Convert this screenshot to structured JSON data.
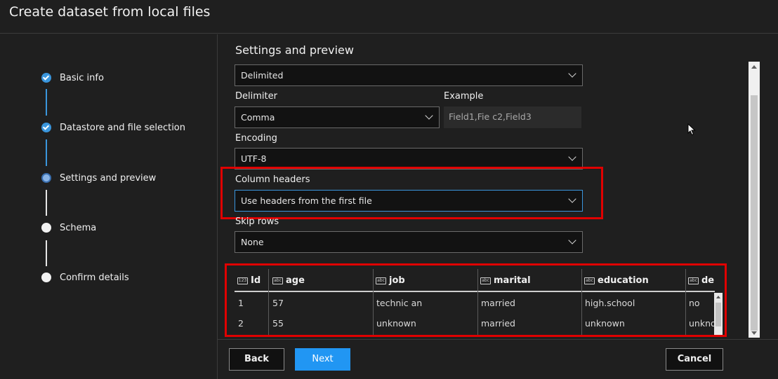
{
  "window": {
    "title": "Create dataset from local files"
  },
  "steps": [
    {
      "label": "Basic info",
      "state": "done"
    },
    {
      "label": "Datastore and file selection",
      "state": "done"
    },
    {
      "label": "Settings and preview",
      "state": "active"
    },
    {
      "label": "Schema",
      "state": "todo"
    },
    {
      "label": "Confirm details",
      "state": "todo"
    }
  ],
  "settings": {
    "section_title": "Settings and preview",
    "file_format": {
      "value": "Delimited"
    },
    "delimiter": {
      "label": "Delimiter",
      "value": "Comma"
    },
    "example": {
      "label": "Example",
      "value": "Field1,Fie c2,Field3"
    },
    "encoding": {
      "label": "Encoding",
      "value": "UTF-8"
    },
    "column_headers": {
      "label": "Column headers",
      "value": "Use headers from the first file"
    },
    "skip_rows": {
      "label": "Skip rows",
      "value": "None"
    }
  },
  "preview": {
    "columns": [
      {
        "name": "Id",
        "type_icon": "numeric-icon"
      },
      {
        "name": "age",
        "type_icon": "text-icon"
      },
      {
        "name": "job",
        "type_icon": "text-icon"
      },
      {
        "name": "marital",
        "type_icon": "text-icon"
      },
      {
        "name": "education",
        "type_icon": "text-icon"
      },
      {
        "name": "de",
        "type_icon": "text-icon"
      }
    ],
    "rows": [
      [
        "1",
        "57",
        "technic an",
        "married",
        "high.school",
        "no"
      ],
      [
        "2",
        "55",
        "unknown",
        "married",
        "unknown",
        "unkno"
      ]
    ]
  },
  "footer": {
    "back": "Back",
    "next": "Next",
    "cancel": "Cancel"
  },
  "colors": {
    "accent": "#2196f3",
    "highlight": "#e00000",
    "check": "#3a96dd"
  }
}
